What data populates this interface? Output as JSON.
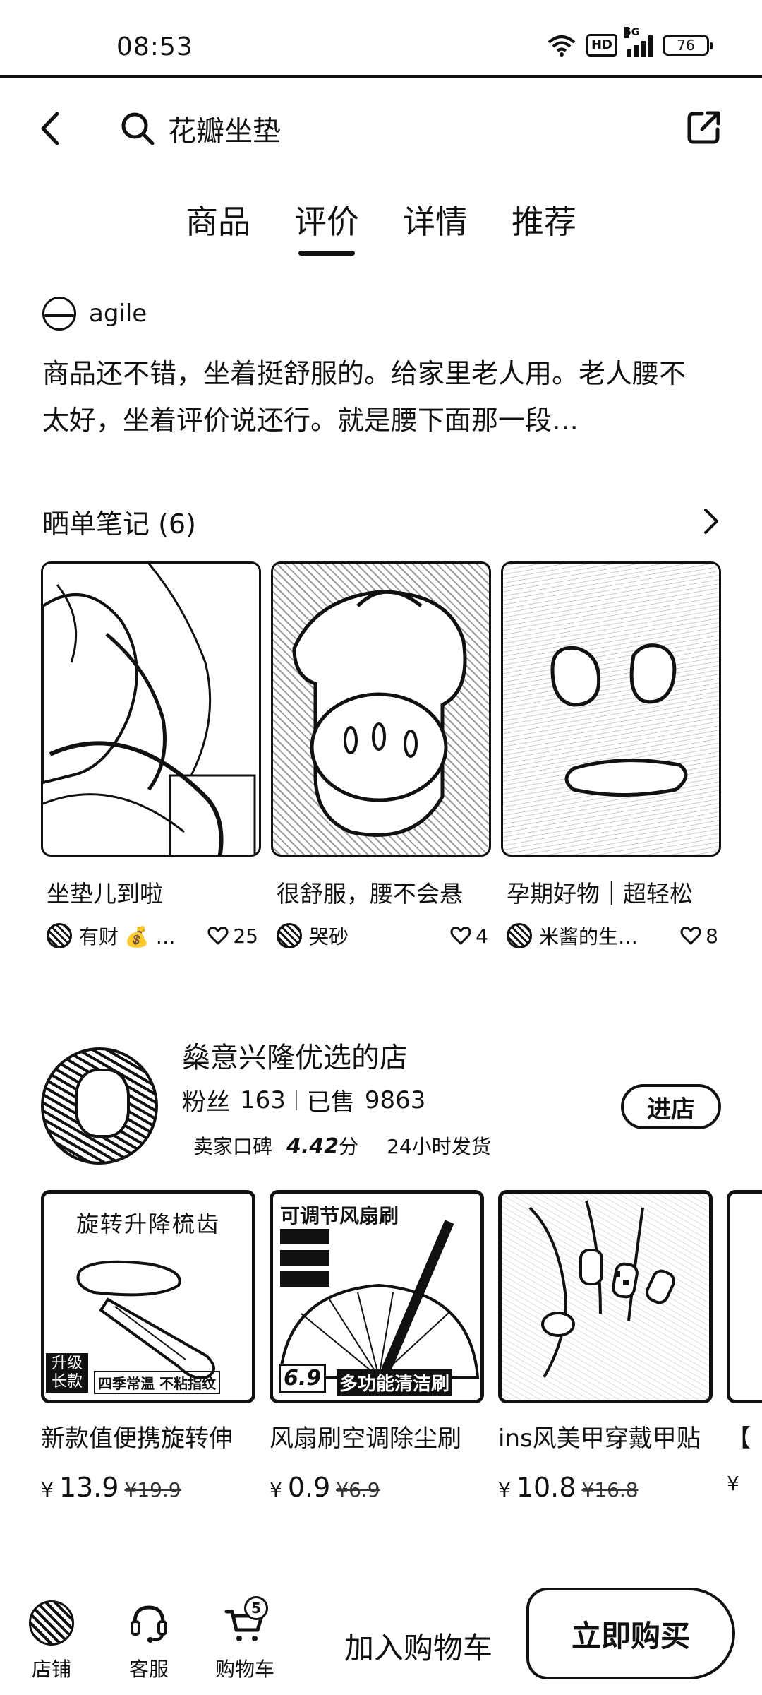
{
  "status_bar": {
    "time": "08:53",
    "network_hd": "HD",
    "network_gen": "5G",
    "battery": "76"
  },
  "header": {
    "search_text": "花瓣坐垫",
    "back_icon": "back-arrow-icon",
    "share_icon": "share-icon"
  },
  "tabs": [
    {
      "label": "商品",
      "active": false
    },
    {
      "label": "评价",
      "active": true
    },
    {
      "label": "详情",
      "active": false
    },
    {
      "label": "推荐",
      "active": false
    }
  ],
  "review": {
    "user": "agile",
    "text": "商品还不错，坐着挺舒服的。给家里老人用。老人腰不太好，坐着评价说还行。就是腰下面那一段…"
  },
  "notes": {
    "title": "晒单笔记 (6)",
    "items": [
      {
        "title": "坐垫儿到啦",
        "author": "有财 💰 …",
        "likes": "25"
      },
      {
        "title": "很舒服，腰不会悬",
        "author": "哭砂",
        "likes": "4"
      },
      {
        "title": "孕期好物｜超轻松",
        "author": "米酱的生…",
        "likes": "8"
      }
    ]
  },
  "shop": {
    "name": "燊意兴隆优选的店",
    "fans_label": "粉丝",
    "fans": "163",
    "sold_label": "已售",
    "sold": "9863",
    "rating_label": "卖家口碑",
    "rating": "4.42",
    "rating_unit": "分",
    "shipping": "24小时发货",
    "enter_label": "进店"
  },
  "products": [
    {
      "title": "新款值便携旋转伸",
      "currency": "¥",
      "price": "13.9",
      "old_price": "¥19.9",
      "img_headline": "旋转升降梳齿",
      "img_badge": "升级长款",
      "img_caption": "四季常温 不粘指纹"
    },
    {
      "title": "风扇刷空调除尘刷",
      "currency": "¥",
      "price": "0.9",
      "old_price": "¥6.9",
      "img_headline": "可调节风扇刷",
      "img_badge": "6.9",
      "img_caption": "多功能清洁刷"
    },
    {
      "title": "ins风美甲穿戴甲贴",
      "currency": "¥",
      "price": "10.8",
      "old_price": "¥16.8"
    },
    {
      "title": "【",
      "currency": "¥",
      "price": "",
      "old_price": ""
    }
  ],
  "bottom_bar": {
    "shop_label": "店铺",
    "service_label": "客服",
    "cart_label": "购物车",
    "cart_count": "5",
    "add_cart_label": "加入购物车",
    "buy_now_label": "立即购买"
  }
}
